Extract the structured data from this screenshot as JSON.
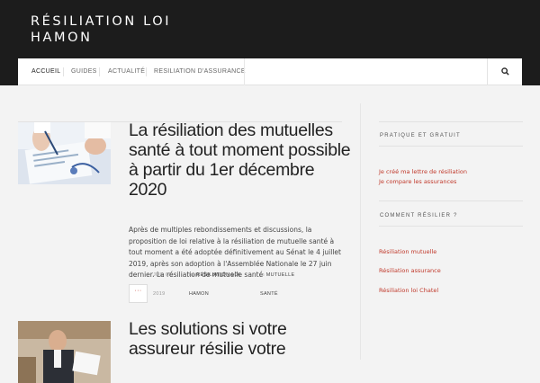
{
  "site": {
    "title": "RÉSILIATION LOI HAMON"
  },
  "nav": {
    "items": [
      "ACCUEIL",
      "GUIDES",
      "ACTUALITÉ",
      "RESILIATION D'ASSURANCE"
    ]
  },
  "posts": [
    {
      "title": "La résiliation des mutuelles santé à tout moment possible à partir du 1er décembre 2020",
      "excerpt": "Après de multiples rebondissements et discussions, la proposition de loi relative à la résiliation de mutuelle santé à tout moment a été adoptée définitivement au Sénat le 4 juillet 2019, après son adoption à l'Assemblée Nationale le 27 juin dernier. La résiliation de mutuelle santé",
      "more": "···",
      "date": "JUIL 05, 2019",
      "by_prefix": "by",
      "author": "RÉSILIATION LOI HAMON",
      "in_prefix": "in",
      "category": "MUTUELLE SANTÉ"
    },
    {
      "title": "Les solutions si votre assureur résilie votre"
    }
  ],
  "sidebar": {
    "widgets": [
      {
        "heading": "PRATIQUE ET GRATUIT",
        "links": [
          "Je créé ma lettre de résiliation",
          "Je compare les assurances"
        ]
      },
      {
        "heading": "COMMENT RÉSILIER ?",
        "links": [
          "Résiliation mutuelle",
          "Résiliation assurance",
          "Résiliation loi Chatel"
        ]
      }
    ]
  },
  "icons": {
    "search": "search-icon"
  },
  "colors": {
    "accent": "#c0392b",
    "header_bg": "#1c1c1c"
  }
}
